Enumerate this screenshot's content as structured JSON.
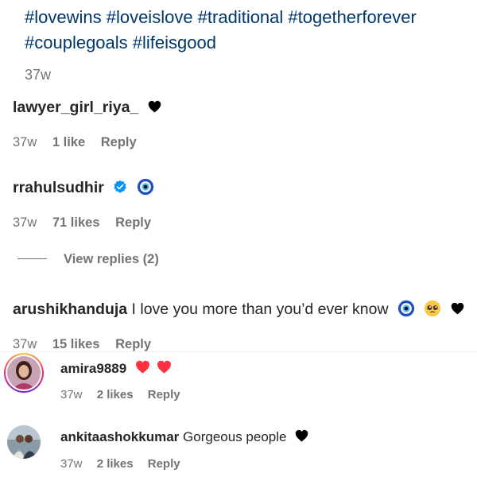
{
  "caption": {
    "text": "#lovewins #loveislove #traditional #togetherforever #couplegoals #lifeisgood",
    "time": "37w"
  },
  "comments": [
    {
      "user": "lawyer_girl_riya_",
      "text": "",
      "time": "37w",
      "likes": "1 like",
      "reply": "Reply",
      "icons": [
        "black-heart"
      ]
    },
    {
      "user": "rrahulsudhir",
      "text": "",
      "time": "37w",
      "likes": "71 likes",
      "reply": "Reply",
      "icons": [
        "verified-badge",
        "evil-eye"
      ]
    },
    {
      "user": "arushikhanduja",
      "text": "I love you more than you’d ever know",
      "time": "37w",
      "likes": "15 likes",
      "reply": "Reply",
      "icons": [
        "evil-eye",
        "pleading-face",
        "black-heart"
      ]
    }
  ],
  "view_replies": {
    "label": "View replies (2)"
  },
  "replies": [
    {
      "user": "amira9889",
      "text": "",
      "time": "37w",
      "likes": "2 likes",
      "reply": "Reply",
      "icons": [
        "red-heart",
        "red-heart"
      ]
    },
    {
      "user": "ankitaashokkumar",
      "text": "Gorgeous people",
      "time": "37w",
      "likes": "2 likes",
      "reply": "Reply",
      "icons": [
        "black-heart"
      ]
    }
  ],
  "colors": {
    "hashtag": "#00376b",
    "meta": "#737373",
    "verified": "#0095f6",
    "heart_red": "#ff3040"
  }
}
